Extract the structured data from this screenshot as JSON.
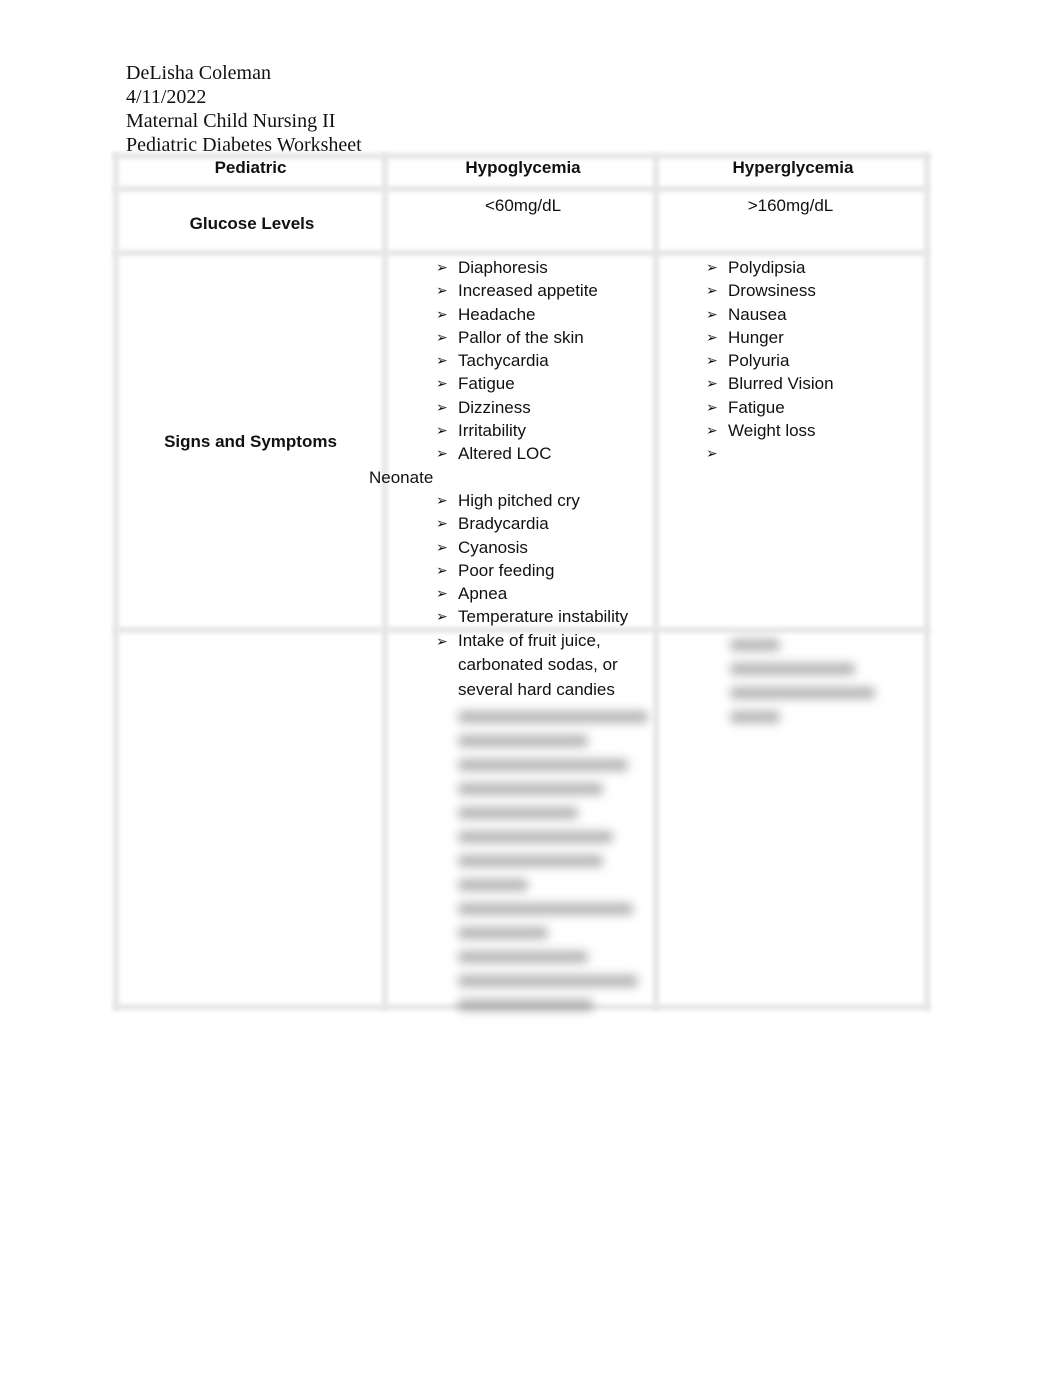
{
  "header": {
    "name": "DeLisha Coleman",
    "date": "4/11/2022",
    "course": "Maternal Child Nursing II",
    "title": "Pediatric Diabetes Worksheet"
  },
  "table": {
    "columns": [
      "Pediatric",
      "Hypoglycemia",
      "Hyperglycemia"
    ],
    "glucose": {
      "label": "Glucose Levels",
      "hypo": "<60mg/dL",
      "hyper": ">160mg/dL"
    },
    "signs": {
      "label": "Signs and Symptoms",
      "hypo": [
        "Diaphoresis",
        "Increased appetite",
        "Headache",
        "Pallor of the skin",
        "Tachycardia",
        "Fatigue",
        "Dizziness",
        "Irritability",
        "Altered LOC"
      ],
      "neonate_label": "Neonate",
      "neonate": [
        "High pitched cry",
        "Bradycardia",
        "Cyanosis",
        "Poor feeding",
        "Apnea",
        "Temperature instability"
      ],
      "hyper": [
        "Polydipsia",
        "Drowsiness",
        "Nausea",
        "Hunger",
        "Polyuria",
        "Blurred Vision",
        "Fatigue",
        "Weight loss",
        ""
      ]
    },
    "treatment": {
      "hypo_visible": [
        "Intake of fruit juice, carbonated sodas, or several hard candies"
      ]
    }
  },
  "icons": {
    "bullet": "arrowhead-bullet-icon"
  }
}
